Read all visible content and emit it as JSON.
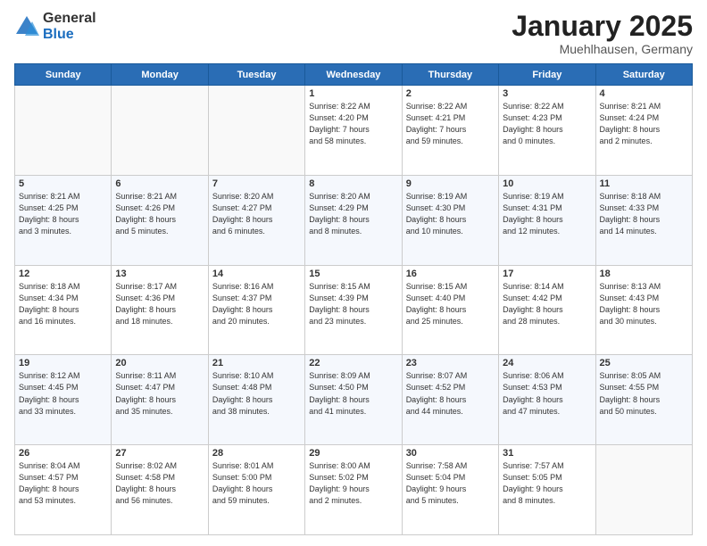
{
  "logo": {
    "general": "General",
    "blue": "Blue"
  },
  "title": {
    "month": "January 2025",
    "location": "Muehlhausen, Germany"
  },
  "days_of_week": [
    "Sunday",
    "Monday",
    "Tuesday",
    "Wednesday",
    "Thursday",
    "Friday",
    "Saturday"
  ],
  "weeks": [
    [
      {
        "day": "",
        "info": ""
      },
      {
        "day": "",
        "info": ""
      },
      {
        "day": "",
        "info": ""
      },
      {
        "day": "1",
        "info": "Sunrise: 8:22 AM\nSunset: 4:20 PM\nDaylight: 7 hours\nand 58 minutes."
      },
      {
        "day": "2",
        "info": "Sunrise: 8:22 AM\nSunset: 4:21 PM\nDaylight: 7 hours\nand 59 minutes."
      },
      {
        "day": "3",
        "info": "Sunrise: 8:22 AM\nSunset: 4:23 PM\nDaylight: 8 hours\nand 0 minutes."
      },
      {
        "day": "4",
        "info": "Sunrise: 8:21 AM\nSunset: 4:24 PM\nDaylight: 8 hours\nand 2 minutes."
      }
    ],
    [
      {
        "day": "5",
        "info": "Sunrise: 8:21 AM\nSunset: 4:25 PM\nDaylight: 8 hours\nand 3 minutes."
      },
      {
        "day": "6",
        "info": "Sunrise: 8:21 AM\nSunset: 4:26 PM\nDaylight: 8 hours\nand 5 minutes."
      },
      {
        "day": "7",
        "info": "Sunrise: 8:20 AM\nSunset: 4:27 PM\nDaylight: 8 hours\nand 6 minutes."
      },
      {
        "day": "8",
        "info": "Sunrise: 8:20 AM\nSunset: 4:29 PM\nDaylight: 8 hours\nand 8 minutes."
      },
      {
        "day": "9",
        "info": "Sunrise: 8:19 AM\nSunset: 4:30 PM\nDaylight: 8 hours\nand 10 minutes."
      },
      {
        "day": "10",
        "info": "Sunrise: 8:19 AM\nSunset: 4:31 PM\nDaylight: 8 hours\nand 12 minutes."
      },
      {
        "day": "11",
        "info": "Sunrise: 8:18 AM\nSunset: 4:33 PM\nDaylight: 8 hours\nand 14 minutes."
      }
    ],
    [
      {
        "day": "12",
        "info": "Sunrise: 8:18 AM\nSunset: 4:34 PM\nDaylight: 8 hours\nand 16 minutes."
      },
      {
        "day": "13",
        "info": "Sunrise: 8:17 AM\nSunset: 4:36 PM\nDaylight: 8 hours\nand 18 minutes."
      },
      {
        "day": "14",
        "info": "Sunrise: 8:16 AM\nSunset: 4:37 PM\nDaylight: 8 hours\nand 20 minutes."
      },
      {
        "day": "15",
        "info": "Sunrise: 8:15 AM\nSunset: 4:39 PM\nDaylight: 8 hours\nand 23 minutes."
      },
      {
        "day": "16",
        "info": "Sunrise: 8:15 AM\nSunset: 4:40 PM\nDaylight: 8 hours\nand 25 minutes."
      },
      {
        "day": "17",
        "info": "Sunrise: 8:14 AM\nSunset: 4:42 PM\nDaylight: 8 hours\nand 28 minutes."
      },
      {
        "day": "18",
        "info": "Sunrise: 8:13 AM\nSunset: 4:43 PM\nDaylight: 8 hours\nand 30 minutes."
      }
    ],
    [
      {
        "day": "19",
        "info": "Sunrise: 8:12 AM\nSunset: 4:45 PM\nDaylight: 8 hours\nand 33 minutes."
      },
      {
        "day": "20",
        "info": "Sunrise: 8:11 AM\nSunset: 4:47 PM\nDaylight: 8 hours\nand 35 minutes."
      },
      {
        "day": "21",
        "info": "Sunrise: 8:10 AM\nSunset: 4:48 PM\nDaylight: 8 hours\nand 38 minutes."
      },
      {
        "day": "22",
        "info": "Sunrise: 8:09 AM\nSunset: 4:50 PM\nDaylight: 8 hours\nand 41 minutes."
      },
      {
        "day": "23",
        "info": "Sunrise: 8:07 AM\nSunset: 4:52 PM\nDaylight: 8 hours\nand 44 minutes."
      },
      {
        "day": "24",
        "info": "Sunrise: 8:06 AM\nSunset: 4:53 PM\nDaylight: 8 hours\nand 47 minutes."
      },
      {
        "day": "25",
        "info": "Sunrise: 8:05 AM\nSunset: 4:55 PM\nDaylight: 8 hours\nand 50 minutes."
      }
    ],
    [
      {
        "day": "26",
        "info": "Sunrise: 8:04 AM\nSunset: 4:57 PM\nDaylight: 8 hours\nand 53 minutes."
      },
      {
        "day": "27",
        "info": "Sunrise: 8:02 AM\nSunset: 4:58 PM\nDaylight: 8 hours\nand 56 minutes."
      },
      {
        "day": "28",
        "info": "Sunrise: 8:01 AM\nSunset: 5:00 PM\nDaylight: 8 hours\nand 59 minutes."
      },
      {
        "day": "29",
        "info": "Sunrise: 8:00 AM\nSunset: 5:02 PM\nDaylight: 9 hours\nand 2 minutes."
      },
      {
        "day": "30",
        "info": "Sunrise: 7:58 AM\nSunset: 5:04 PM\nDaylight: 9 hours\nand 5 minutes."
      },
      {
        "day": "31",
        "info": "Sunrise: 7:57 AM\nSunset: 5:05 PM\nDaylight: 9 hours\nand 8 minutes."
      },
      {
        "day": "",
        "info": ""
      }
    ]
  ]
}
